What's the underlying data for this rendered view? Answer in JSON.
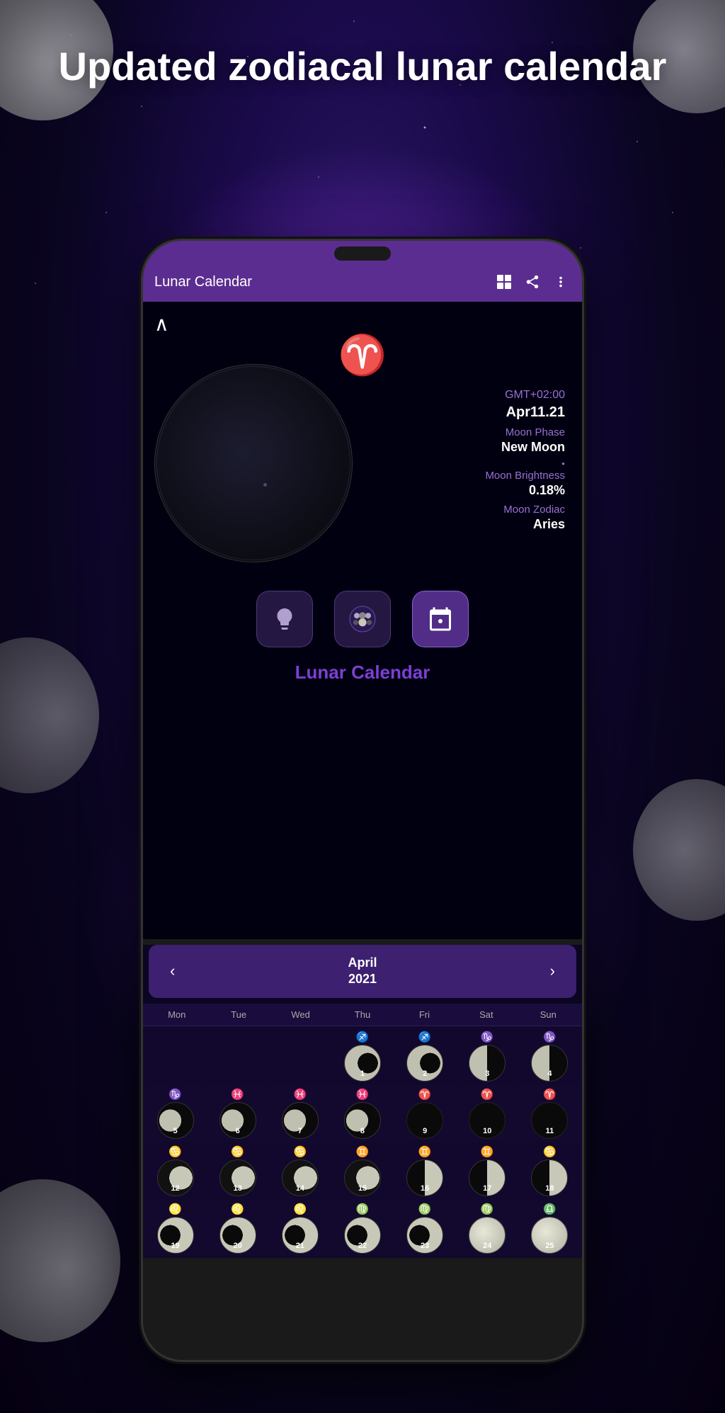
{
  "background": {
    "headline": "Updated zodiacal lunar calendar"
  },
  "app": {
    "title": "Lunar Calendar",
    "toolbar": {
      "grid_icon": "grid-icon",
      "share_icon": "share-icon",
      "more_icon": "more-icon"
    }
  },
  "moon_display": {
    "timezone": "GMT+02:00",
    "date": "Apr11.21",
    "phase_label": "Moon Phase",
    "phase_value": "New Moon",
    "brightness_label": "Moon Brightness",
    "brightness_value": "0.18%",
    "zodiac_label": "Moon Zodiac",
    "zodiac_value": "Aries"
  },
  "action_buttons": [
    {
      "id": "tip",
      "icon": "💡"
    },
    {
      "id": "moon",
      "icon": "🌙"
    },
    {
      "id": "calendar",
      "icon": "📅"
    }
  ],
  "calendar_label": "Lunar Calendar",
  "month_nav": {
    "prev": "‹",
    "next": "›",
    "month": "April",
    "year": "2021"
  },
  "day_headers": [
    "Mon",
    "Tue",
    "Wed",
    "Thu",
    "Fri",
    "Sat",
    "Sun"
  ],
  "calendar_rows": [
    {
      "days": [
        {
          "empty": true
        },
        {
          "empty": true
        },
        {
          "empty": true
        },
        {
          "num": "1",
          "zodiac": "♐",
          "phase": "waning-gibbous"
        },
        {
          "num": "2",
          "zodiac": "♐",
          "phase": "waning-gibbous"
        },
        {
          "num": "3",
          "zodiac": "♑",
          "phase": "last-quarter"
        },
        {
          "num": "4",
          "zodiac": "♑",
          "phase": "last-quarter"
        }
      ]
    },
    {
      "days": [
        {
          "num": "5",
          "zodiac": "♑",
          "phase": "waning-crescent"
        },
        {
          "num": "6",
          "zodiac": "♓",
          "phase": "waning-crescent"
        },
        {
          "num": "7",
          "zodiac": "♓",
          "phase": "waning-crescent"
        },
        {
          "num": "8",
          "zodiac": "♓",
          "phase": "waning-crescent"
        },
        {
          "num": "9",
          "zodiac": "♈",
          "phase": "new"
        },
        {
          "num": "10",
          "zodiac": "♈",
          "phase": "new"
        },
        {
          "num": "11",
          "zodiac": "♈",
          "phase": "new"
        }
      ]
    },
    {
      "days": [
        {
          "num": "12",
          "zodiac": "♋",
          "phase": "waxing-crescent"
        },
        {
          "num": "13",
          "zodiac": "♋",
          "phase": "waxing-crescent"
        },
        {
          "num": "14",
          "zodiac": "♋",
          "phase": "waxing-crescent"
        },
        {
          "num": "15",
          "zodiac": "♊",
          "phase": "waxing-crescent"
        },
        {
          "num": "16",
          "zodiac": "♊",
          "phase": "first-quarter"
        },
        {
          "num": "17",
          "zodiac": "♊",
          "phase": "first-quarter"
        },
        {
          "num": "18",
          "zodiac": "♋",
          "phase": "first-quarter"
        }
      ]
    },
    {
      "days": [
        {
          "num": "19",
          "zodiac": "♌",
          "phase": "waxing-gibbous"
        },
        {
          "num": "20",
          "zodiac": "♌",
          "phase": "waxing-gibbous"
        },
        {
          "num": "21",
          "zodiac": "♌",
          "phase": "waxing-gibbous"
        },
        {
          "num": "22",
          "zodiac": "♍",
          "phase": "waxing-gibbous"
        },
        {
          "num": "23",
          "zodiac": "♍",
          "phase": "waxing-gibbous"
        },
        {
          "num": "24",
          "zodiac": "♍",
          "phase": "full"
        },
        {
          "num": "25",
          "zodiac": "♎",
          "phase": "full"
        }
      ]
    }
  ]
}
